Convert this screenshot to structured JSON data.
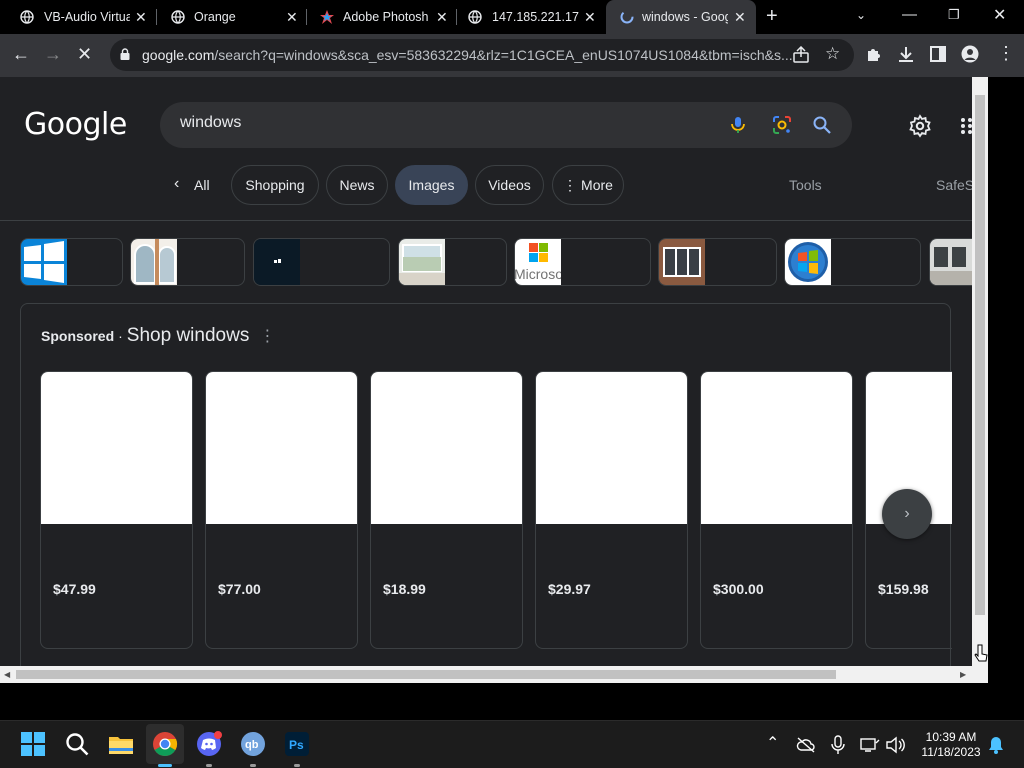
{
  "tabs": [
    {
      "title": "VB-Audio Virtua",
      "active": false
    },
    {
      "title": "Orange",
      "active": false
    },
    {
      "title": "Adobe Photosh",
      "active": false
    },
    {
      "title": "147.185.221.17",
      "active": false
    },
    {
      "title": "windows - Goog",
      "active": true
    }
  ],
  "address_bar": {
    "host": "google.com",
    "rest": "/search?q=windows&sca_esv=583632294&rlz=1C1GCEA_enUS1074US1084&tbm=isch&s..."
  },
  "google": {
    "logo": "Google",
    "search_value": "windows",
    "chips": [
      {
        "label": "All",
        "active": false
      },
      {
        "label": "Shopping",
        "active": false
      },
      {
        "label": "News",
        "active": false
      },
      {
        "label": "Images",
        "active": true
      },
      {
        "label": "Videos",
        "active": false
      },
      {
        "label": "More",
        "active": false
      }
    ],
    "tools": "Tools",
    "safesearch": "SafeS",
    "shop": {
      "sponsored": "Sponsored",
      "separator": "·",
      "title": "Shop windows",
      "prices": [
        "$47.99",
        "$77.00",
        "$18.99",
        "$29.97",
        "$300.00",
        "$159.98"
      ]
    },
    "thumb_text": "Microso"
  },
  "clock": {
    "time": "10:39 AM",
    "date": "11/18/2023"
  },
  "colors": {
    "background": "#202124",
    "chip_active": "#394457",
    "tabstrip": "#000000",
    "toolbar": "#35363a"
  }
}
